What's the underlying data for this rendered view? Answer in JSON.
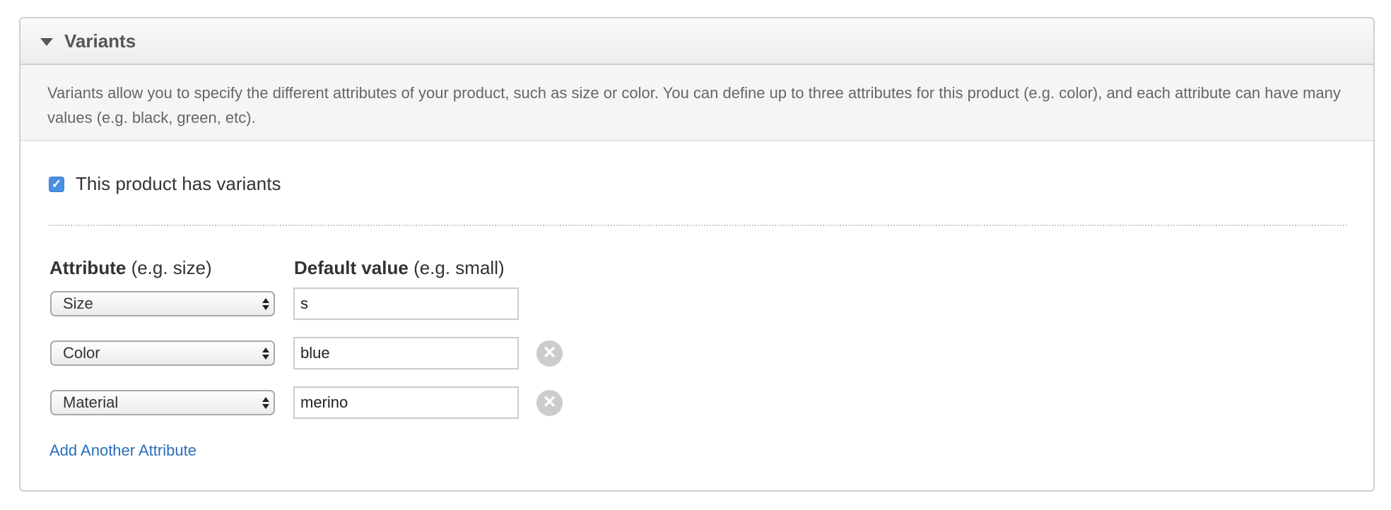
{
  "panel": {
    "title": "Variants",
    "description": "Variants allow you to specify the different attributes of your product, such as size or color. You can define up to three attributes for this product (e.g. color), and each attribute can have many values (e.g. black, green, etc)."
  },
  "has_variants": {
    "checked": true,
    "label": "This product has variants"
  },
  "columns": {
    "attribute_label": "Attribute",
    "attribute_hint": "(e.g. size)",
    "value_label": "Default value",
    "value_hint": "(e.g. small)"
  },
  "rows": [
    {
      "attribute": "Size",
      "value": "s",
      "removable": false
    },
    {
      "attribute": "Color",
      "value": "blue",
      "removable": true
    },
    {
      "attribute": "Material",
      "value": "merino",
      "removable": true
    }
  ],
  "add_link": "Add Another Attribute",
  "icons": {
    "collapse": "caret-down-icon",
    "check": "checkmark-icon",
    "select_arrows": "up-down-arrows-icon",
    "remove": "close-circle-icon"
  },
  "colors": {
    "accent": "#4a90e2",
    "link": "#2a6ebb",
    "remove_icon": "#cccccc"
  }
}
